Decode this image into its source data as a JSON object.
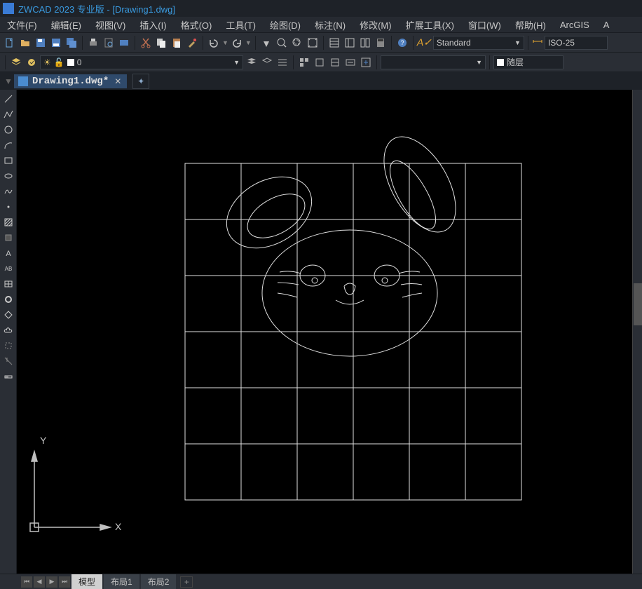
{
  "titlebar": {
    "text": "ZWCAD 2023 专业版 - [Drawing1.dwg]"
  },
  "menus": [
    {
      "label": "文件(F)"
    },
    {
      "label": "编辑(E)"
    },
    {
      "label": "视图(V)"
    },
    {
      "label": "插入(I)"
    },
    {
      "label": "格式(O)"
    },
    {
      "label": "工具(T)"
    },
    {
      "label": "绘图(D)"
    },
    {
      "label": "标注(N)"
    },
    {
      "label": "修改(M)"
    },
    {
      "label": "扩展工具(X)"
    },
    {
      "label": "窗口(W)"
    },
    {
      "label": "帮助(H)"
    },
    {
      "label": "ArcGIS"
    },
    {
      "label": "A"
    }
  ],
  "toolbar1": {
    "style_dd": "Standard",
    "dimstyle_dd": "ISO-25"
  },
  "toolbar2": {
    "layer_dd": "0",
    "color_dd": "随层",
    "linetype_dd": ""
  },
  "doc_tab": {
    "label": "Drawing1.dwg*"
  },
  "bottomtabs": {
    "tabs": [
      {
        "label": "模型",
        "active": true
      },
      {
        "label": "布局1",
        "active": false
      },
      {
        "label": "布局2",
        "active": false
      }
    ]
  },
  "axis": {
    "x": "X",
    "y": "Y"
  }
}
